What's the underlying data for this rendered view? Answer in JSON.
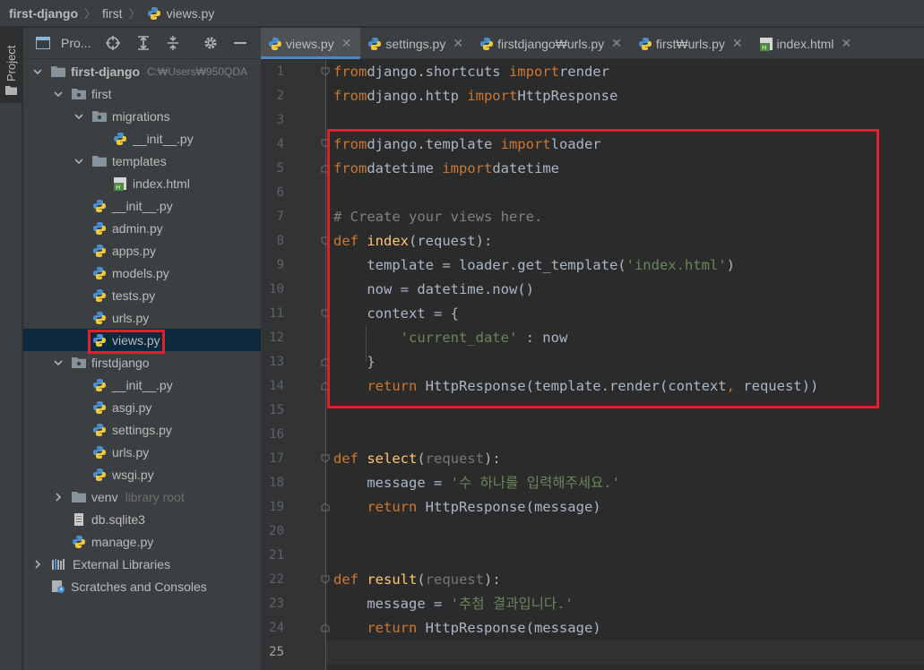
{
  "breadcrumb": {
    "project": "first-django",
    "folder": "first",
    "file": "views.py"
  },
  "stripe": {
    "label": "Project"
  },
  "project_panel": {
    "title": "Pro...",
    "tree": [
      {
        "label": "first-django",
        "hint": "C:₩Users₩950QDA",
        "type": "root-folder",
        "depth": 0,
        "expanded": true
      },
      {
        "label": "first",
        "type": "package",
        "depth": 1,
        "expanded": true
      },
      {
        "label": "migrations",
        "type": "package",
        "depth": 2,
        "expanded": true
      },
      {
        "label": "__init__.py",
        "type": "py",
        "depth": 3
      },
      {
        "label": "templates",
        "type": "folder",
        "depth": 2,
        "expanded": true
      },
      {
        "label": "index.html",
        "type": "html",
        "depth": 3
      },
      {
        "label": "__init__.py",
        "type": "py",
        "depth": 2
      },
      {
        "label": "admin.py",
        "type": "py",
        "depth": 2
      },
      {
        "label": "apps.py",
        "type": "py",
        "depth": 2
      },
      {
        "label": "models.py",
        "type": "py",
        "depth": 2
      },
      {
        "label": "tests.py",
        "type": "py",
        "depth": 2
      },
      {
        "label": "urls.py",
        "type": "py",
        "depth": 2
      },
      {
        "label": "views.py",
        "type": "py",
        "depth": 2,
        "selected": true
      },
      {
        "label": "firstdjango",
        "type": "package",
        "depth": 1,
        "expanded": true
      },
      {
        "label": "__init__.py",
        "type": "py",
        "depth": 2
      },
      {
        "label": "asgi.py",
        "type": "py",
        "depth": 2
      },
      {
        "label": "settings.py",
        "type": "py",
        "depth": 2
      },
      {
        "label": "urls.py",
        "type": "py",
        "depth": 2
      },
      {
        "label": "wsgi.py",
        "type": "py",
        "depth": 2
      },
      {
        "label": "venv",
        "hint": "library root",
        "type": "folder-lib",
        "depth": 1,
        "expanded": false
      },
      {
        "label": "db.sqlite3",
        "type": "db",
        "depth": 1
      },
      {
        "label": "manage.py",
        "type": "py",
        "depth": 1
      },
      {
        "label": "External Libraries",
        "type": "ext",
        "depth": 0,
        "expanded": false
      },
      {
        "label": "Scratches and Consoles",
        "type": "scratch",
        "depth": 0
      }
    ]
  },
  "tabs": [
    {
      "label": "views.py",
      "type": "py",
      "active": true
    },
    {
      "label": "settings.py",
      "type": "py"
    },
    {
      "label": "firstdjango₩urls.py",
      "type": "py"
    },
    {
      "label": "first₩urls.py",
      "type": "py"
    },
    {
      "label": "index.html",
      "type": "html"
    }
  ],
  "editor": {
    "current_line": 25,
    "lines": [
      [
        [
          "kw",
          "from"
        ],
        [
          "",
          "django.shortcuts "
        ],
        [
          "kw",
          "import"
        ],
        [
          "",
          "render"
        ]
      ],
      [
        [
          "kw",
          "from"
        ],
        [
          "",
          "django.http "
        ],
        [
          "kw",
          "import"
        ],
        [
          "",
          "HttpResponse"
        ]
      ],
      [],
      [
        [
          "kw",
          "from"
        ],
        [
          "",
          "django.template "
        ],
        [
          "kw",
          "import"
        ],
        [
          "",
          "loader"
        ]
      ],
      [
        [
          "kw",
          "from"
        ],
        [
          "",
          "datetime "
        ],
        [
          "kw",
          "import"
        ],
        [
          "",
          "datetime"
        ]
      ],
      [],
      [
        [
          "cmt",
          "# Create your views here."
        ]
      ],
      [
        [
          "kw",
          "def "
        ],
        [
          "fn",
          "index"
        ],
        [
          "",
          "(request):"
        ]
      ],
      [
        [
          "",
          "    template = loader.get_template("
        ],
        [
          "str",
          "'index.html'"
        ],
        [
          "",
          ")"
        ]
      ],
      [
        [
          "",
          "    now = datetime.now()"
        ]
      ],
      [
        [
          "",
          "    context = {"
        ]
      ],
      [
        [
          "",
          "        "
        ],
        [
          "str",
          "'current_date'"
        ],
        [
          "",
          " : now"
        ]
      ],
      [
        [
          "",
          "    }"
        ]
      ],
      [
        [
          "",
          "    "
        ],
        [
          "kw",
          "return "
        ],
        [
          "",
          "HttpResponse(template.render(context"
        ],
        [
          "kw",
          ","
        ],
        [
          "",
          " request))"
        ]
      ],
      [],
      [],
      [
        [
          "kw",
          "def "
        ],
        [
          "fn",
          "select"
        ],
        [
          "",
          "("
        ],
        [
          "param",
          "request"
        ],
        [
          "",
          "):"
        ]
      ],
      [
        [
          "",
          "    message = "
        ],
        [
          "str",
          "'수 하나를 입력해주세요.'"
        ]
      ],
      [
        [
          "",
          "    "
        ],
        [
          "kw",
          "return "
        ],
        [
          "",
          "HttpResponse(message)"
        ]
      ],
      [],
      [],
      [
        [
          "kw",
          "def "
        ],
        [
          "fn",
          "result"
        ],
        [
          "",
          "("
        ],
        [
          "param",
          "request"
        ],
        [
          "",
          "):"
        ]
      ],
      [
        [
          "",
          "    message = "
        ],
        [
          "str",
          "'추첨 결과입니다.'"
        ]
      ],
      [
        [
          "",
          "    "
        ],
        [
          "kw",
          "return "
        ],
        [
          "",
          "HttpResponse(message)"
        ]
      ],
      []
    ]
  },
  "colors": {
    "highlight_box": "#e3202a",
    "keyword": "#cc7832",
    "function": "#ffc66d",
    "string": "#6a8759",
    "comment": "#808080"
  }
}
